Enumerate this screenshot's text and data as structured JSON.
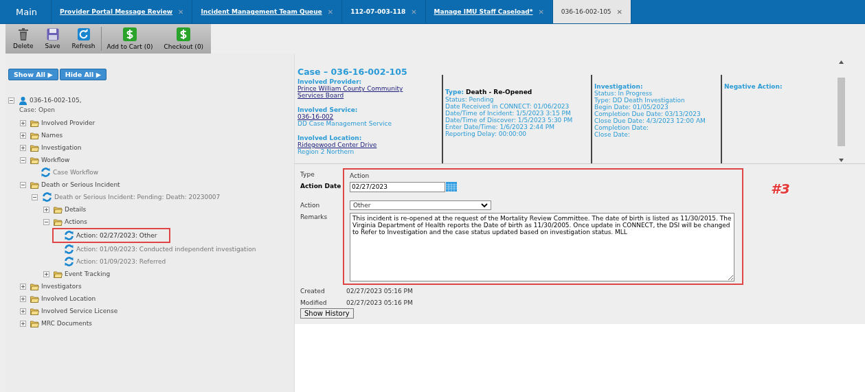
{
  "tabs": [
    {
      "label": "Main",
      "kind": "home",
      "selected": false
    },
    {
      "label": "Provider Portal Message Review",
      "kind": "link",
      "selected": false
    },
    {
      "label": "Incident Management Team Queue",
      "kind": "link",
      "selected": false
    },
    {
      "label": "112-07-003-118",
      "kind": "plain",
      "selected": false
    },
    {
      "label": "Manage IMU Staff Caseload*",
      "kind": "link",
      "selected": false
    },
    {
      "label": "036-16-002-105",
      "kind": "plain",
      "selected": true
    }
  ],
  "close_glyph": "✕",
  "toolbar": [
    {
      "label": "Delete"
    },
    {
      "label": "Save"
    },
    {
      "label": "Refresh"
    },
    {
      "label": "Add to Cart (0)"
    },
    {
      "label": "Checkout (0)"
    }
  ],
  "tree_buttons": [
    {
      "label": "Show All ▶"
    },
    {
      "label": "Hide All ▶"
    }
  ],
  "tree": [
    {
      "label": "036-16-002-105,",
      "sublabel": "Case: Open",
      "kind": "case",
      "expanded": true,
      "children": [
        {
          "label": "Involved Provider",
          "kind": "folder",
          "expanded": false
        },
        {
          "label": "Names",
          "kind": "folder",
          "expanded": false
        },
        {
          "label": "Investigation",
          "kind": "folder",
          "expanded": false
        },
        {
          "label": "Workflow",
          "kind": "folder",
          "expanded": true,
          "children": [
            {
              "label": "Case Workflow",
              "kind": "record",
              "highlighted": false
            }
          ]
        },
        {
          "label": "Death or Serious Incident",
          "kind": "folder",
          "expanded": true,
          "children": [
            {
              "label": "Death or Serious Incident: Pending: Death: 20230007",
              "kind": "record",
              "expanded": true,
              "highlighted": false,
              "children": [
                {
                  "label": "Details",
                  "kind": "folder",
                  "expanded": false
                },
                {
                  "label": "Actions",
                  "kind": "folder",
                  "expanded": true,
                  "children": [
                    {
                      "label": "Action: 02/27/2023: Other",
                      "kind": "record",
                      "highlighted": true
                    },
                    {
                      "label": "Action: 01/09/2023: Conducted independent investigation",
                      "kind": "record",
                      "highlighted": false
                    },
                    {
                      "label": "Action: 01/09/2023: Referred",
                      "kind": "record",
                      "highlighted": false
                    }
                  ]
                },
                {
                  "label": "Event Tracking",
                  "kind": "folder",
                  "expanded": false
                }
              ]
            }
          ]
        },
        {
          "label": "Investigators",
          "kind": "folder",
          "expanded": false
        },
        {
          "label": "Involved Location",
          "kind": "folder",
          "expanded": false
        },
        {
          "label": "Involved Service License",
          "kind": "folder",
          "expanded": false
        },
        {
          "label": "MRC Documents",
          "kind": "folder",
          "expanded": false
        }
      ]
    }
  ],
  "case": {
    "title": "Case – 036-16-002-105",
    "provider_label": "Involved Provider:",
    "provider": "Prince William County Community Services Board",
    "service_label": "Involved Service:",
    "service_link": "036-16-002",
    "service_name": "DD Case Management Service",
    "location_label": "Involved Location:",
    "location_link": "Ridegewood Center Drive",
    "location_region": "Region 2 Northern",
    "type_label": "Type:",
    "type_value": "Death - Re-Opened",
    "type_lines": [
      "Status: Pending",
      "Date Received in CONNECT: 01/06/2023",
      "Date/Time of Incident: 1/5/2023 3:15 PM",
      "Date/Time of Discover: 1/5/2023 5:30 PM",
      "Enter Date/Time: 1/6/2023 2:44 PM",
      "Reporting Delay: 00:00:00"
    ],
    "investigation_label": "Investigation:",
    "investigation_lines": [
      "Status: In Progress",
      "Type: DD Death Investigation",
      "Begin Date: 01/05/2023",
      "Completion Due Date: 03/13/2023",
      "Close Due Date: 4/3/2023 12:00 AM",
      "Completion Date:",
      "Close Date:"
    ],
    "negative_label": "Negative Action:"
  },
  "form": {
    "type_label": "Type",
    "type_value": "Action",
    "date_label": "Action Date",
    "date_value": "02/27/2023",
    "action_label": "Action",
    "action_value": "Other",
    "remarks_label": "Remarks",
    "remarks": "This incident is re-opened at the request of the Mortality Review Committee. The date of birth is listed as 11/30/2015. The Virginia Department of Health reports the Date of birth as 11/30/2005. Once update in CONNECT, the DSI will be changed to Refer to Investigation and the case status updated based on investigation status. MLL",
    "created_label": "Created",
    "created": "02/27/2023 05:16 PM",
    "modified_label": "Modified",
    "modified": "02/27/2023 05:16 PM",
    "history_button": "Show History"
  },
  "annotation": "#3"
}
